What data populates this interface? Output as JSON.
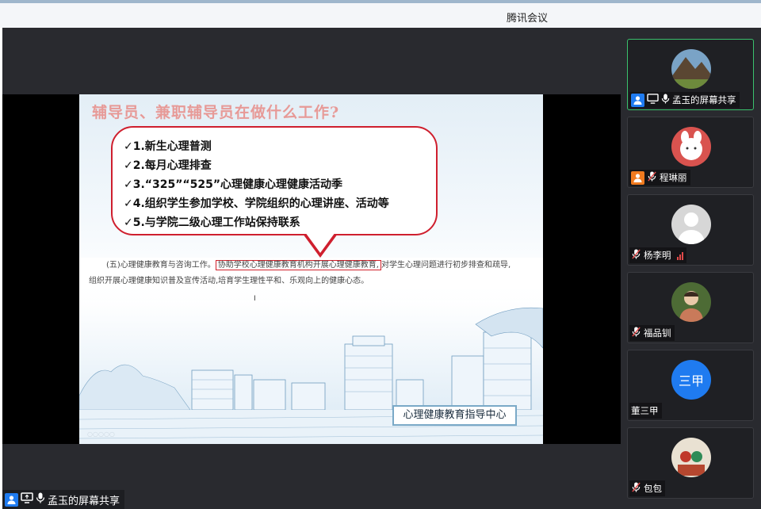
{
  "window": {
    "title": "腾讯会议"
  },
  "slide": {
    "title": "辅导员、兼职辅导员在做什么工作?",
    "bubble_items": [
      "✓1.新生心理普测",
      "✓2.每月心理排查",
      "✓3.“325”“525”心理健康心理健康活动季",
      "✓4.组织学生参加学校、学院组织的心理讲座、活动等",
      "✓5.与学院二级心理工作站保持联系"
    ],
    "paragraph": {
      "prefix": "(五)心理健康教育与咨询工作。",
      "highlight": "协助学校心理健康教育机构开展心理健康教育,",
      "suffix": "对学生心理问题进行初步排查和疏导,",
      "line2": "组织开展心理健康知识普及宣传活动,培育学生理性平和、乐观向上的健康心态。"
    },
    "badge": "心理健康教育指导中心"
  },
  "share_label": "孟玉的屏幕共享",
  "participants": [
    {
      "name": "孟玉的屏幕共享",
      "role": "host",
      "mic": "on",
      "active": true,
      "avatar": "mountain-photo"
    },
    {
      "name": "程琳丽",
      "role": "cohost",
      "mic": "muted",
      "avatar": "bunny-cartoon"
    },
    {
      "name": "杨李明",
      "mic": "muted",
      "avatar": "default-person",
      "signal": "weak"
    },
    {
      "name": "福品钏",
      "mic": "muted",
      "avatar": "person-photo"
    },
    {
      "name": "董三甲",
      "mic": "none",
      "avatar_text": "三甲",
      "avatar_color": "#1f7bf0"
    },
    {
      "name": "包包",
      "mic": "muted",
      "avatar": "group-photo"
    }
  ],
  "colors": {
    "accent": "#1f7bf0",
    "active_border": "#3ac16d",
    "highlight_red": "#cf1f2e"
  }
}
